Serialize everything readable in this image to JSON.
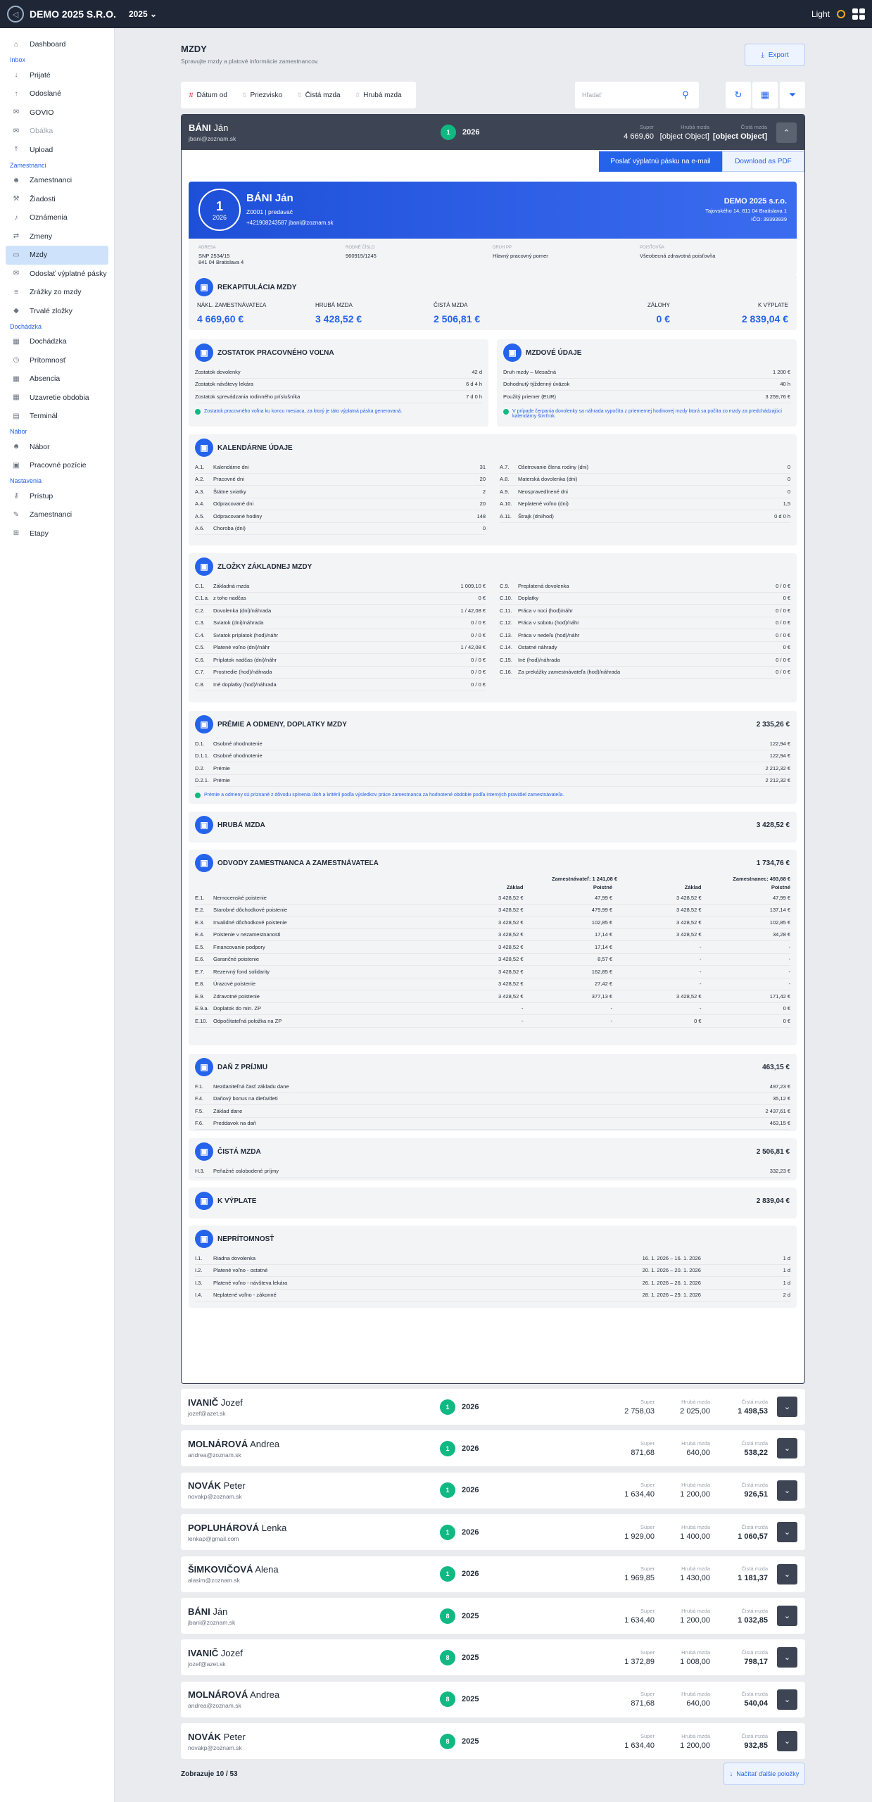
{
  "app": {
    "company": "DEMO 2025 S.R.O.",
    "year": "2025",
    "theme": "Light"
  },
  "sidebar": {
    "items": [
      {
        "type": "item",
        "label": "Dashboard",
        "icon": "home-icon"
      },
      {
        "type": "section",
        "label": "Inbox"
      },
      {
        "type": "item",
        "label": "Prijaté",
        "icon": "arrow-down-icon"
      },
      {
        "type": "item",
        "label": "Odoslané",
        "icon": "arrow-up-icon"
      },
      {
        "type": "item",
        "label": "GOVIO",
        "icon": "mail-icon"
      },
      {
        "type": "item",
        "label": "Obálka",
        "icon": "envelope-icon",
        "muted": true
      },
      {
        "type": "item",
        "label": "Upload",
        "icon": "upload-icon"
      },
      {
        "type": "section",
        "label": "Zamestnanci"
      },
      {
        "type": "item",
        "label": "Zamestnanci",
        "icon": "users-icon"
      },
      {
        "type": "item",
        "label": "Žiadosti",
        "icon": "hammer-icon"
      },
      {
        "type": "item",
        "label": "Oznámenia",
        "icon": "bell-icon"
      },
      {
        "type": "item",
        "label": "Zmeny",
        "icon": "swap-icon"
      },
      {
        "type": "item",
        "label": "Mzdy",
        "icon": "money-icon",
        "active": true
      },
      {
        "type": "item",
        "label": "Odoslať výplatné pásky",
        "icon": "send-icon"
      },
      {
        "type": "item",
        "label": "Zrážky zo mzdy",
        "icon": "list-icon"
      },
      {
        "type": "item",
        "label": "Trvalé zložky",
        "icon": "tag-icon"
      },
      {
        "type": "section",
        "label": "Dochádzka"
      },
      {
        "type": "item",
        "label": "Dochádzka",
        "icon": "calendar-icon"
      },
      {
        "type": "item",
        "label": "Prítomnosť",
        "icon": "clock-icon"
      },
      {
        "type": "item",
        "label": "Absencia",
        "icon": "calendar-x-icon"
      },
      {
        "type": "item",
        "label": "Uzavretie obdobia",
        "icon": "lock-calendar-icon"
      },
      {
        "type": "item",
        "label": "Terminál",
        "icon": "terminal-icon"
      },
      {
        "type": "section",
        "label": "Nábor"
      },
      {
        "type": "item",
        "label": "Nábor",
        "icon": "user-plus-icon"
      },
      {
        "type": "item",
        "label": "Pracovné pozície",
        "icon": "briefcase-icon"
      },
      {
        "type": "section",
        "label": "Nastavenia"
      },
      {
        "type": "item",
        "label": "Prístup",
        "icon": "key-icon"
      },
      {
        "type": "item",
        "label": "Zamestnanci",
        "icon": "user-edit-icon"
      },
      {
        "type": "item",
        "label": "Etapy",
        "icon": "sitemap-icon"
      }
    ]
  },
  "header": {
    "title": "MZDY",
    "subtitle": "Spravujte mzdy a platové informácie zamestnancov.",
    "export": "Export"
  },
  "filters": {
    "sort": [
      "Dátum od",
      "Priezvisko",
      "Čistá mzda",
      "Hrubá mzda"
    ],
    "search_placeholder": "Hľadať"
  },
  "open": {
    "surname": "BÁNI",
    "name": "Ján",
    "email": "jbani@zoznam.sk",
    "badge": "1",
    "year": "2026",
    "super_l": "Super",
    "super": "4 669,60",
    "gross_l": "Hrubá mzda",
    "gross": {
      "title": "HRUBÁ MZDA",
      "total": "3 428,52 €"
    },
    "net_l": "Čistá mzda",
    "net": {
      "title": "ČISTÁ MZDA",
      "total": "2 506,81 €",
      "rows": [
        [
          "H.3.",
          "Peňažné oslobodené príjmy",
          "332,23 €"
        ]
      ]
    },
    "btn_mail": "Poslať výplatnú pásku na e-mail",
    "btn_pdf": "Download as PDF",
    "slip": {
      "month": "1",
      "year": "2026",
      "fullname": "BÁNI Ján",
      "id_role": "Z0001  |  predavač",
      "contact": "+421908243587     jbani@zoznam.sk",
      "company": "DEMO 2025 s.r.o.",
      "addr": "Tajovského 14, 811 04 Bratislava 1",
      "ico": "IČO: 39393939",
      "info": [
        {
          "l": "ADRESA",
          "v": "SNP 2534/15",
          "v2": "841 04 Bratislava 4"
        },
        {
          "l": "RODNÉ ČÍSLO",
          "v": "960915/1245",
          "v2": ""
        },
        {
          "l": "DRUH PP",
          "v": "Hlavný pracovný pomer",
          "v2": ""
        },
        {
          "l": "POISŤOVŇA",
          "v": "Všeobecná zdravotná poisťovňa",
          "v2": ""
        }
      ]
    },
    "recap": {
      "title": "REKAPITULÁCIA MZDY",
      "items": [
        {
          "l": "NÁKL. ZAMESTNÁVATEĽA",
          "v": "4 669,60 €"
        },
        {
          "l": "HRUBÁ MZDA",
          "v": "3 428,52 €"
        },
        {
          "l": "ČISTÁ MZDA",
          "v": "2 506,81 €"
        },
        {
          "l": "ZÁLOHY",
          "v": "0 €"
        },
        {
          "l": "K VÝPLATE",
          "v": "2 839,04 €"
        }
      ]
    },
    "leave": {
      "title": "ZOSTATOK PRACOVNÉHO VOĽNA",
      "rows": [
        [
          "Zostatok dovolenky",
          "42 d"
        ],
        [
          "Zostatok návštevy lekára",
          "6 d 4 h"
        ],
        [
          "Zostatok sprevádzania rodinného príslušníka",
          "7 d 0 h"
        ]
      ],
      "note": "Zostatok pracovného voľna ku koncu mesiaca, za ktorý je táto výplatná páska generovaná."
    },
    "wage": {
      "title": "MZDOVÉ ÚDAJE",
      "rows": [
        [
          "Druh mzdy – Mesačná",
          "1 200 €"
        ],
        [
          "Dohodnutý týždenný úväzok",
          "40 h"
        ],
        [
          "Použitý priemer (EUR)",
          "3 259,76 €"
        ]
      ],
      "note": "V prípade čerpania dovolenky sa náhrada vypočíta z priemernej hodinovej mzdy ktorá sa počíta zo mzdy za predchádzajúci kalendárny štvrťrok."
    },
    "cal": {
      "title": "KALENDÁRNE ÚDAJE",
      "left": [
        [
          "A.1.",
          "Kalendárne dni",
          "31"
        ],
        [
          "A.2.",
          "Pracovné dni",
          "20"
        ],
        [
          "A.3.",
          "Štátne sviatky",
          "2"
        ],
        [
          "A.4.",
          "Odpracované dni",
          "20"
        ],
        [
          "A.5.",
          "Odpracované hodiny",
          "148"
        ],
        [
          "A.6.",
          "Choroba (dni)",
          "0"
        ]
      ],
      "right": [
        [
          "A.7.",
          "Ošetrovanie člena rodiny (dni)",
          "0"
        ],
        [
          "A.8.",
          "Materská dovolenka (dni)",
          "0"
        ],
        [
          "A.9.",
          "Neospravedlnené dni",
          "0"
        ],
        [
          "A.10.",
          "Neplatené voľno (dni)",
          "1,5"
        ],
        [
          "A.11.",
          "Štrajk (dni/hod)",
          "0 d 0 h"
        ]
      ]
    },
    "comp": {
      "title": "ZLOŽKY ZÁKLADNEJ MZDY",
      "left": [
        [
          "C.1.",
          "Základná mzda",
          "1 009,10 €"
        ],
        [
          "C.1.a.",
          "z toho nadčas",
          "0 €"
        ],
        [
          "C.2.",
          "Dovolenka (dni)/náhrada",
          "1 / 42,08 €"
        ],
        [
          "C.3.",
          "Sviatok (dni)/náhrada",
          "0 / 0 €"
        ],
        [
          "C.4.",
          "Sviatok príplatok (hod)/náhr",
          "0 / 0 €"
        ],
        [
          "C.5.",
          "Platené voľno (dni)/náhr",
          "1 / 42,08 €"
        ],
        [
          "C.6.",
          "Príplatok nadčas (dni)/náhr",
          "0 / 0 €"
        ],
        [
          "C.7.",
          "Prostredie (hod)/náhrada",
          "0 / 0 €"
        ],
        [
          "C.8.",
          "Iné doplatky (hod)/náhrada",
          "0 / 0 €"
        ]
      ],
      "right": [
        [
          "C.9.",
          "Preplatená dovolenka",
          "0 / 0 €"
        ],
        [
          "C.10.",
          "Doplatky",
          "0 €"
        ],
        [
          "C.11.",
          "Práca v noci (hod)/náhr",
          "0 / 0 €"
        ],
        [
          "C.12.",
          "Práca v sobotu (hod)/náhr",
          "0 / 0 €"
        ],
        [
          "C.13.",
          "Práca v nedeľu (hod)/náhr",
          "0 / 0 €"
        ],
        [
          "C.14.",
          "Ostatné náhrady",
          "0 €"
        ],
        [
          "C.15.",
          "Iné (hod)/náhrada",
          "0 / 0 €"
        ],
        [
          "C.16.",
          "Za prekážky zamestnávateľa (hod)/náhrada",
          "0 / 0 €"
        ]
      ]
    },
    "bonus": {
      "title": "PRÉMIE A ODMENY, DOPLATKY MZDY",
      "total": "2 335,26 €",
      "rows": [
        [
          "D.1.",
          "Osobné ohodnotenie",
          "122,94 €"
        ],
        [
          "D.1.1.",
          "Osobné ohodnotenie",
          "122,94 €"
        ],
        [
          "D.2.",
          "Prémie",
          "2 212,32 €"
        ],
        [
          "D.2.1.",
          "Prémie",
          "2 212,32 €"
        ]
      ],
      "note": "Prémie a odmeny sú priznané z dôvodu splnenia úloh a kritérií podľa výsledkov práce zamestnanca za hodnotené obdobie podľa interných pravidiel zamestnávateľa."
    },
    "levy": {
      "title": "ODVODY ZAMESTNANCA A ZAMESTNÁVATEĽA",
      "total": "1 734,76 €",
      "emp_h": "Zamestnávateľ: 1 241,08 €",
      "ee_h": "Zamestnanec: 493,68 €",
      "cols": [
        "Základ",
        "Poistné",
        "Základ",
        "Poistné"
      ],
      "rows": [
        [
          "E.1.",
          "Nemocenské poistenie",
          "3 428,52 €",
          "47,99 €",
          "3 428,52 €",
          "47,99 €"
        ],
        [
          "E.2.",
          "Starobné dôchodkové poistenie",
          "3 428,52 €",
          "479,99 €",
          "3 428,52 €",
          "137,14 €"
        ],
        [
          "E.3.",
          "Invalidné dôchodkové poistenie",
          "3 428,52 €",
          "102,85 €",
          "3 428,52 €",
          "102,85 €"
        ],
        [
          "E.4.",
          "Poistenie v nezamestnanosti",
          "3 428,52 €",
          "17,14 €",
          "3 428,52 €",
          "34,28 €"
        ],
        [
          "E.5.",
          "Financovanie podpory",
          "3 428,52 €",
          "17,14 €",
          "-",
          "-"
        ],
        [
          "E.6.",
          "Garančné poistenie",
          "3 428,52 €",
          "8,57 €",
          "-",
          "-"
        ],
        [
          "E.7.",
          "Rezervný fond solidarity",
          "3 428,52 €",
          "162,85 €",
          "-",
          "-"
        ],
        [
          "E.8.",
          "Úrazové poistenie",
          "3 428,52 €",
          "27,42 €",
          "-",
          "-"
        ],
        [
          "E.9.",
          "Zdravotné poistenie",
          "3 428,52 €",
          "377,13 €",
          "3 428,52 €",
          "171,42 €"
        ],
        [
          "E.9.a.",
          "Doplatok do min. ZP",
          "-",
          "-",
          "-",
          "0 €"
        ],
        [
          "E.10.",
          "Odpočítateľná položka na ZP",
          "-",
          "-",
          "0 €",
          "0 €"
        ]
      ]
    },
    "tax": {
      "title": "DAŇ Z PRÍJMU",
      "total": "463,15 €",
      "rows": [
        [
          "F.1.",
          "Nezdaniteľná časť základu dane",
          "497,23 €"
        ],
        [
          "F.4.",
          "Daňový bonus na dieťa/deti",
          "35,12 €"
        ],
        [
          "F.5.",
          "Základ dane",
          "2 437,61 €"
        ],
        [
          "F.6.",
          "Preddavok na daň",
          "463,15 €"
        ]
      ]
    },
    "pay": {
      "title": "K VÝPLATE",
      "total": "2 839,04 €"
    },
    "abs": {
      "title": "NEPRÍTOMNOSŤ",
      "rows": [
        [
          "I.1.",
          "Riadna dovolenka",
          "16. 1. 2026  –  16. 1. 2026",
          "1 d"
        ],
        [
          "I.2.",
          "Platené voľno - ostatné",
          "20. 1. 2026  –  20. 1. 2026",
          "1 d"
        ],
        [
          "I.3.",
          "Platené voľno - návšteva lekára",
          "26. 1. 2026  –  26. 1. 2026",
          "1 d"
        ],
        [
          "I.4.",
          "Neplatené voľno - zákonné",
          "28. 1. 2026  –  29. 1. 2026",
          "2 d"
        ]
      ]
    }
  },
  "cards": [
    {
      "surname": "IVANIČ",
      "name": "Jozef",
      "email": "jozef@azet.sk",
      "badge": "1",
      "year": "2026",
      "super": "2 758,03",
      "gross": "2 025,00",
      "net": "1 498,53"
    },
    {
      "surname": "MOLNÁROVÁ",
      "name": "Andrea",
      "email": "andrea@zoznam.sk",
      "badge": "1",
      "year": "2026",
      "super": "871,68",
      "gross": "640,00",
      "net": "538,22"
    },
    {
      "surname": "NOVÁK",
      "name": "Peter",
      "email": "novakp@zoznam.sk",
      "badge": "1",
      "year": "2026",
      "super": "1 634,40",
      "gross": "1 200,00",
      "net": "926,51"
    },
    {
      "surname": "POPLUHÁROVÁ",
      "name": "Lenka",
      "email": "lenkap@gmail.com",
      "badge": "1",
      "year": "2026",
      "super": "1 929,00",
      "gross": "1 400,00",
      "net": "1 060,57"
    },
    {
      "surname": "ŠIMKOVIČOVÁ",
      "name": "Alena",
      "email": "alasim@zoznam.sk",
      "badge": "1",
      "year": "2026",
      "super": "1 969,85",
      "gross": "1 430,00",
      "net": "1 181,37"
    },
    {
      "surname": "BÁNI",
      "name": "Ján",
      "email": "jbani@zoznam.sk",
      "badge": "8",
      "year": "2025",
      "super": "1 634,40",
      "gross": "1 200,00",
      "net": "1 032,85"
    },
    {
      "surname": "IVANIČ",
      "name": "Jozef",
      "email": "jozef@azet.sk",
      "badge": "8",
      "year": "2025",
      "super": "1 372,89",
      "gross": "1 008,00",
      "net": "798,17"
    },
    {
      "surname": "MOLNÁROVÁ",
      "name": "Andrea",
      "email": "andrea@zoznam.sk",
      "badge": "8",
      "year": "2025",
      "super": "871,68",
      "gross": "640,00",
      "net": "540,04"
    },
    {
      "surname": "NOVÁK",
      "name": "Peter",
      "email": "novakp@zoznam.sk",
      "badge": "8",
      "year": "2025",
      "super": "1 634,40",
      "gross": "1 200,00",
      "net": "932,85"
    }
  ],
  "card_labels": {
    "super": "Super",
    "gross": "Hrubá mzda",
    "net": "Čistá mzda"
  },
  "footer": {
    "count": "Zobrazuje 10 / 53",
    "more": "Načítať ďalšie položky"
  }
}
